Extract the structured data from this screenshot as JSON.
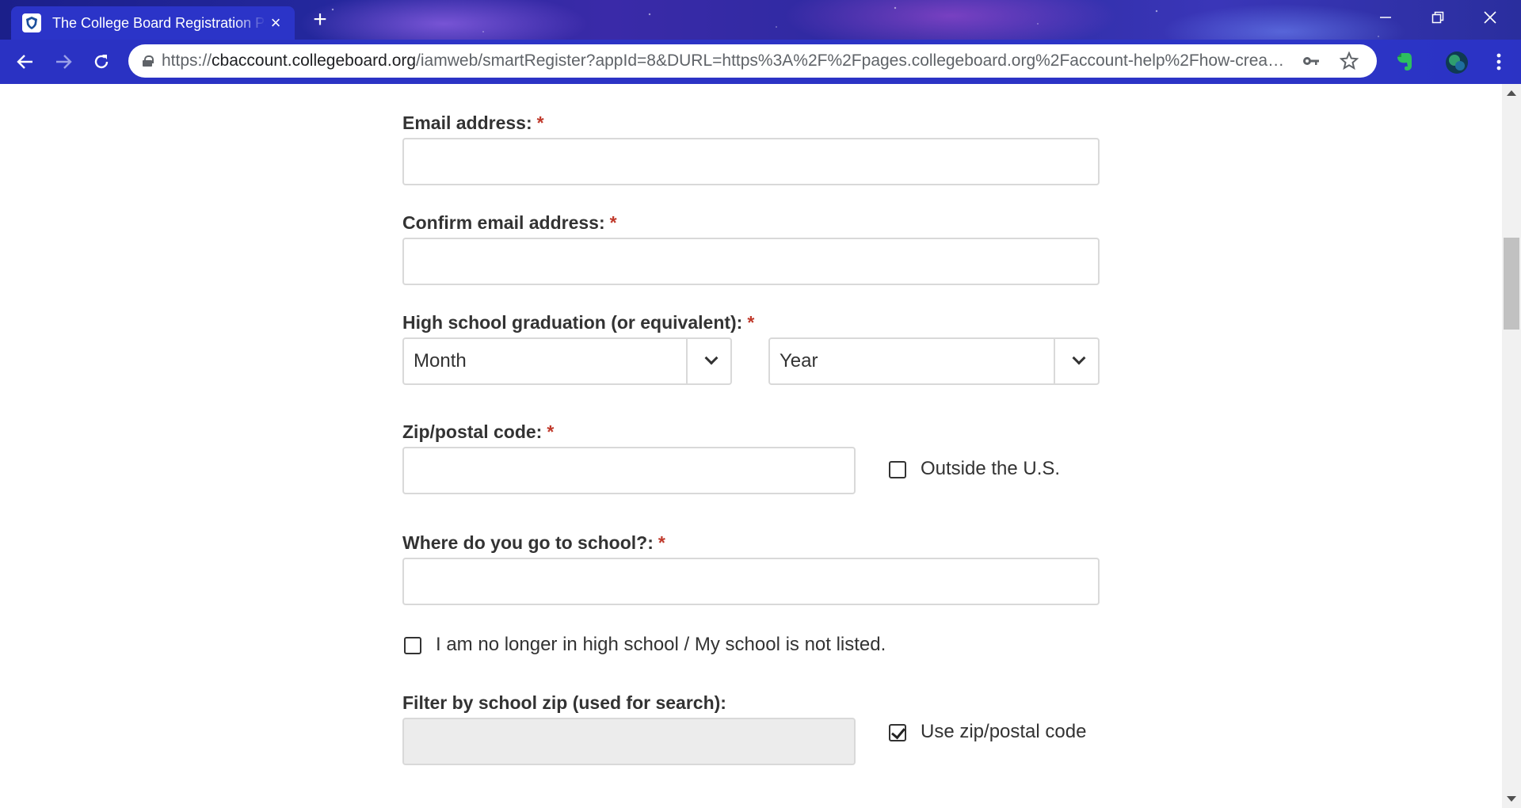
{
  "browser": {
    "tab_title": "The College Board Registration Page",
    "tab_close": "×",
    "new_tab": "+",
    "url_scheme": "https://",
    "url_host": "cbaccount.collegeboard.org",
    "url_rest": "/iamweb/smartRegister?appId=8&DURL=https%3A%2F%2Fpages.collegeboard.org%2Faccount-help%2Fhow-create...",
    "icons": [
      "back-icon",
      "forward-icon",
      "reload-icon",
      "lock-icon",
      "key-icon",
      "star-icon",
      "evernote-icon",
      "profile-avatar",
      "menu-icon"
    ]
  },
  "form": {
    "email": {
      "label": "Email address:",
      "required": "*"
    },
    "confirm_email": {
      "label": "Confirm email address:",
      "required": "*"
    },
    "graduation": {
      "label": "High school graduation (or equivalent):",
      "required": "*",
      "month": "Month",
      "year": "Year"
    },
    "zip": {
      "label": "Zip/postal code:",
      "required": "*",
      "outside_us": "Outside the U.S."
    },
    "school": {
      "label": "Where do you go to school?:",
      "required": "*",
      "not_listed": "I am no longer in high school / My school is not listed."
    },
    "filter_zip": {
      "label": "Filter by school zip (used for search):",
      "use_zip": "Use zip/postal code",
      "use_zip_checked": true
    }
  },
  "colors": {
    "required": "#c0392b",
    "label": "#333333",
    "border": "#d9d9d9",
    "chrome": "#2b34c8"
  }
}
